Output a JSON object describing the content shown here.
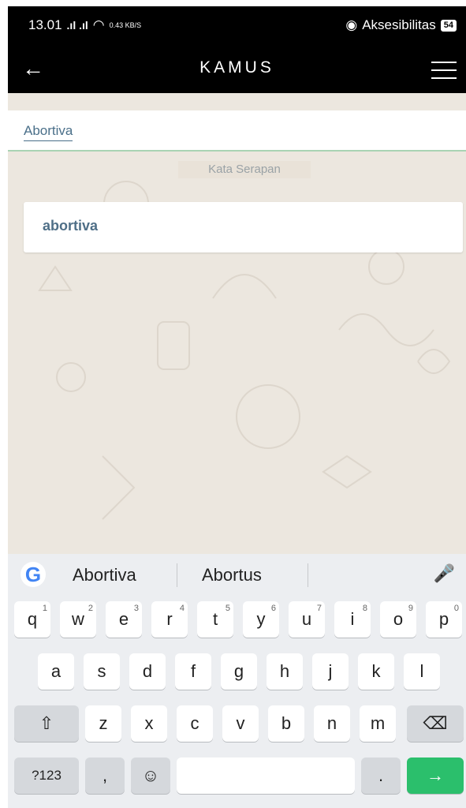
{
  "status": {
    "time": "13.01",
    "signal": ".ıl .ıl",
    "data_speed": "0.43 KB/S",
    "accessibility": "Aksesibilitas",
    "battery": "54"
  },
  "appbar": {
    "title": "KAMUS"
  },
  "search": {
    "value": "Abortiva"
  },
  "category_label": "Kata Serapan",
  "result": {
    "word": "abortiva"
  },
  "keyboard": {
    "suggestions": [
      "Abortiva",
      "Abortus"
    ],
    "row1": [
      {
        "k": "q",
        "n": "1"
      },
      {
        "k": "w",
        "n": "2"
      },
      {
        "k": "e",
        "n": "3"
      },
      {
        "k": "r",
        "n": "4"
      },
      {
        "k": "t",
        "n": "5"
      },
      {
        "k": "y",
        "n": "6"
      },
      {
        "k": "u",
        "n": "7"
      },
      {
        "k": "i",
        "n": "8"
      },
      {
        "k": "o",
        "n": "9"
      },
      {
        "k": "p",
        "n": "0"
      }
    ],
    "row2": [
      "a",
      "s",
      "d",
      "f",
      "g",
      "h",
      "j",
      "k",
      "l"
    ],
    "row3": [
      "z",
      "x",
      "c",
      "v",
      "b",
      "n",
      "m"
    ],
    "symbols_label": "?123",
    "comma": ",",
    "period": "."
  }
}
